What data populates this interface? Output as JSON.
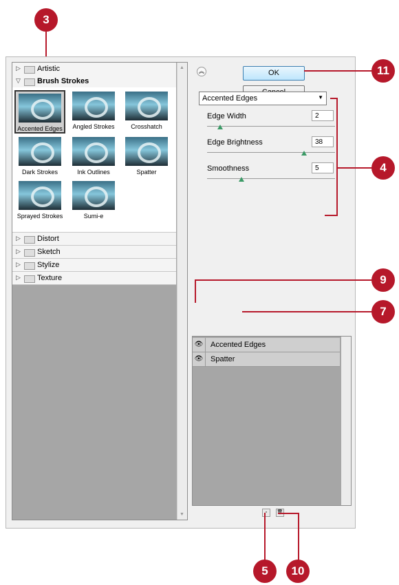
{
  "left_panel": {
    "categories_top": [
      {
        "label": "Artistic",
        "expanded": false
      },
      {
        "label": "Brush Strokes",
        "expanded": true
      }
    ],
    "brush_strokes_thumbs": [
      {
        "caption": "Accented Edges",
        "selected": true
      },
      {
        "caption": "Angled Strokes"
      },
      {
        "caption": "Crosshatch"
      },
      {
        "caption": "Dark Strokes"
      },
      {
        "caption": "Ink Outlines"
      },
      {
        "caption": "Spatter"
      },
      {
        "caption": "Sprayed Strokes"
      },
      {
        "caption": "Sumi-e"
      }
    ],
    "categories_bottom": [
      {
        "label": "Distort"
      },
      {
        "label": "Sketch"
      },
      {
        "label": "Stylize"
      },
      {
        "label": "Texture"
      }
    ]
  },
  "right_panel": {
    "ok_label": "OK",
    "cancel_label": "Cancel",
    "filter_select": "Accented Edges",
    "params": [
      {
        "label": "Edge Width",
        "value": "2",
        "level": 0.1
      },
      {
        "label": "Edge Brightness",
        "value": "38",
        "level": 0.76
      },
      {
        "label": "Smoothness",
        "value": "5",
        "level": 0.27
      }
    ],
    "layers": [
      {
        "name": "Accented Edges",
        "visible": true
      },
      {
        "name": "Spatter",
        "visible": true
      }
    ]
  },
  "callouts": {
    "c3": "3",
    "c11": "11",
    "c4": "4",
    "c9": "9",
    "c7": "7",
    "c5": "5",
    "c10": "10"
  },
  "colors": {
    "callout": "#b6182a",
    "panel_gray": "#a6a6a6",
    "slider_knob": "#3b9a66"
  }
}
